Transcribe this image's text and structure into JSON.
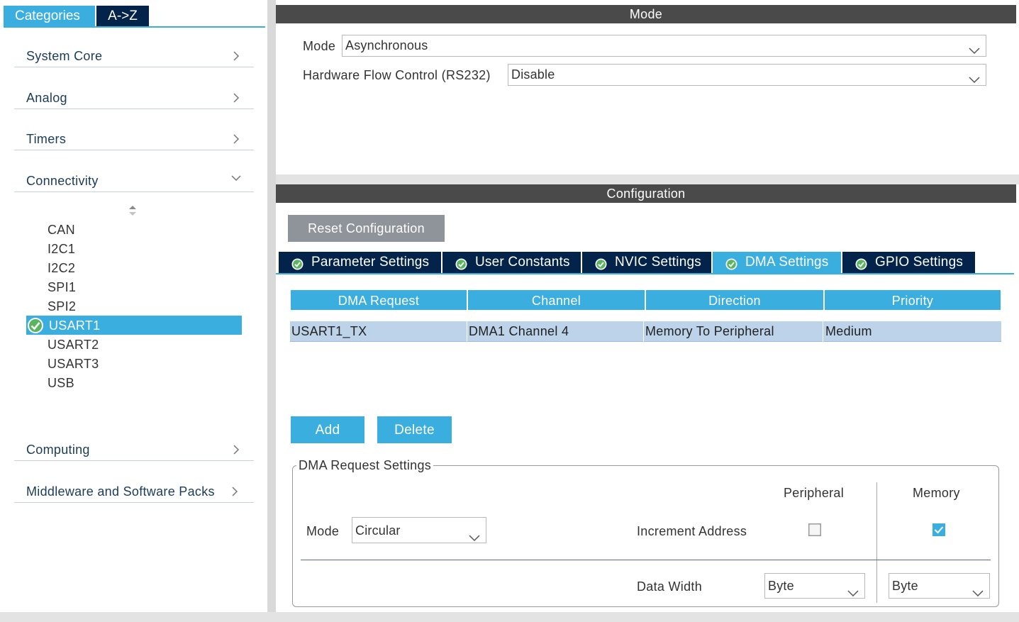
{
  "left_tabs": [
    {
      "label": "Categories",
      "active": true
    },
    {
      "label": "A->Z",
      "active": false
    }
  ],
  "categories": {
    "system_core": "System Core",
    "analog": "Analog",
    "timers": "Timers",
    "connectivity": "Connectivity",
    "computing": "Computing",
    "middleware": "Middleware and Software Packs"
  },
  "peripherals": [
    "CAN",
    "I2C1",
    "I2C2",
    "SPI1",
    "SPI2",
    "USART1",
    "USART2",
    "USART3",
    "USB"
  ],
  "selected_peripheral": "USART1",
  "mode_panel": {
    "title": "Mode",
    "mode_label": "Mode",
    "mode_value": "Asynchronous",
    "flow_label": "Hardware Flow Control (RS232)",
    "flow_value": "Disable"
  },
  "config_panel": {
    "title": "Configuration",
    "reset_label": "Reset Configuration",
    "tabs": [
      {
        "label": "Parameter Settings",
        "active": false
      },
      {
        "label": "User Constants",
        "active": false
      },
      {
        "label": "NVIC Settings",
        "active": false
      },
      {
        "label": "DMA Settings",
        "active": true
      },
      {
        "label": "GPIO Settings",
        "active": false
      }
    ]
  },
  "dma_table": {
    "headers": [
      "DMA Request",
      "Channel",
      "Direction",
      "Priority"
    ],
    "rows": [
      [
        "USART1_TX",
        "DMA1 Channel 4",
        "Memory To Peripheral",
        "Medium"
      ]
    ]
  },
  "buttons": {
    "add": "Add",
    "delete": "Delete"
  },
  "dma_request_settings": {
    "title": "DMA Request Settings",
    "mode_label": "Mode",
    "mode_value": "Circular",
    "peripheral_header": "Peripheral",
    "memory_header": "Memory",
    "increment_label": "Increment Address",
    "increment_peripheral": false,
    "increment_memory": true,
    "data_width_label": "Data Width",
    "data_width_peripheral": "Byte",
    "data_width_memory": "Byte"
  },
  "colors": {
    "accent": "#3baee0",
    "navy": "#03234b",
    "header_gray": "#4a4a4a",
    "row_selected": "#bcd3ea"
  }
}
